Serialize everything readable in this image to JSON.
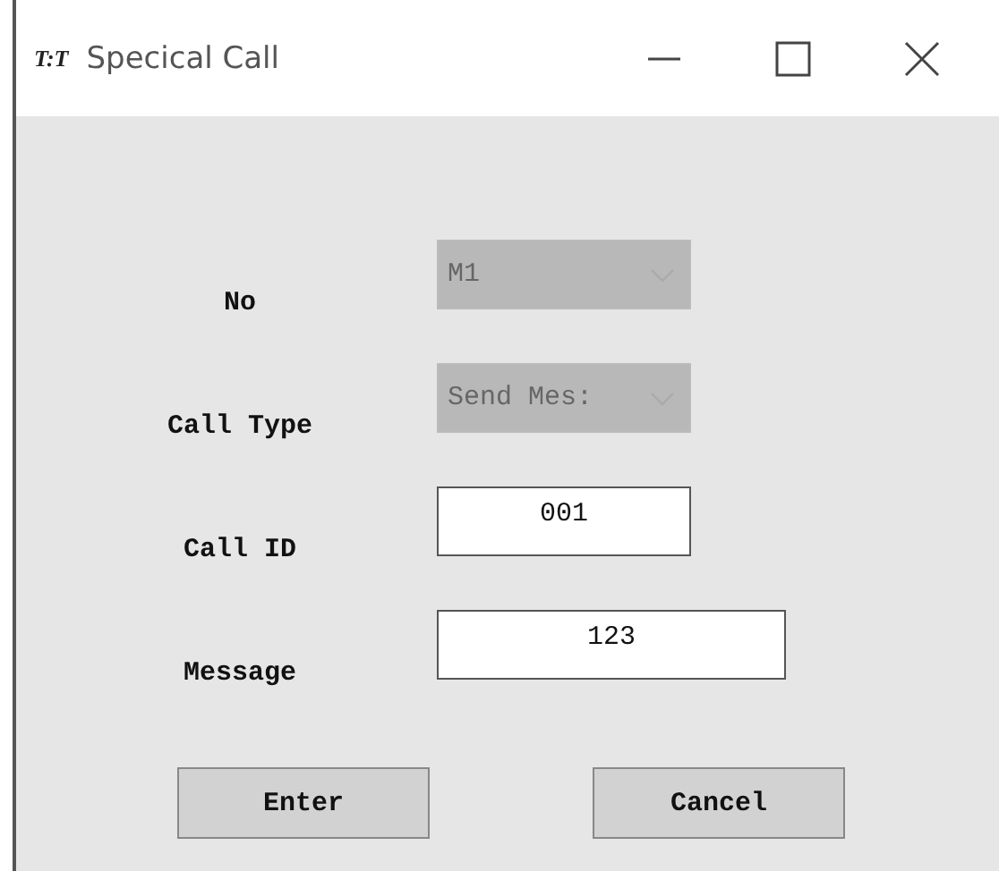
{
  "window": {
    "icon_text": "T:T",
    "title": "Specical Call"
  },
  "fields": [
    {
      "label": "No",
      "kind": "combo",
      "value": "M1",
      "disabled": true
    },
    {
      "label": "Call Type",
      "kind": "combo",
      "value": "Send Mes:",
      "disabled": true
    },
    {
      "label": "Call ID",
      "kind": "text",
      "value": "001",
      "wide": false
    },
    {
      "label": "Message",
      "kind": "text",
      "value": "123",
      "wide": true
    }
  ],
  "buttons": [
    "Enter",
    "Cancel"
  ]
}
